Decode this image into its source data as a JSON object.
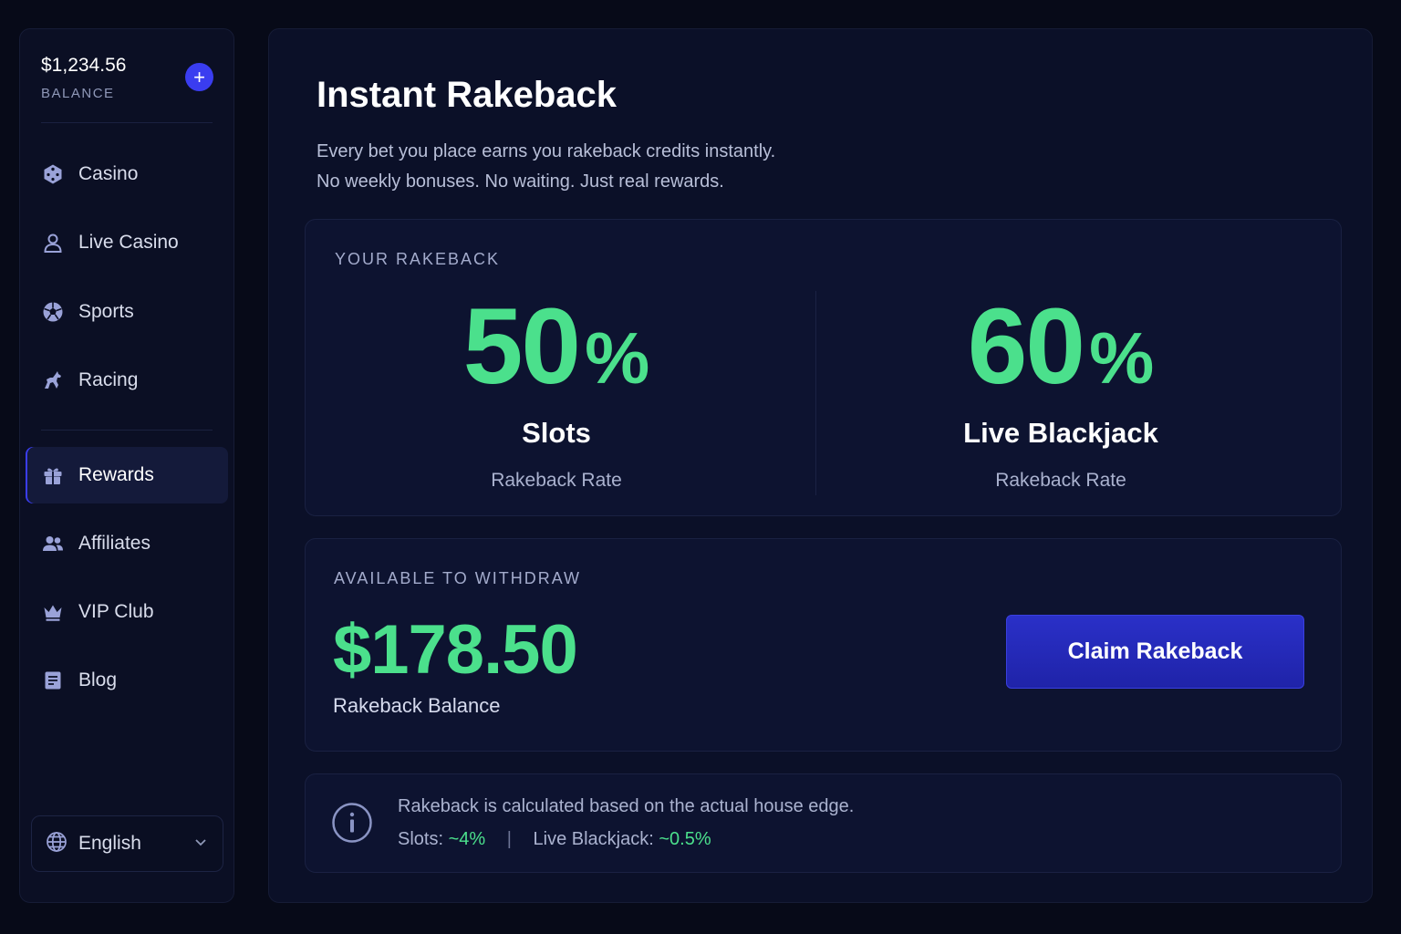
{
  "sidebar": {
    "balance_amount": "$1,234.56",
    "balance_label": "BALANCE",
    "add_label": "+",
    "items": [
      {
        "label": "Casino",
        "icon": "dice-icon"
      },
      {
        "label": "Live Casino",
        "icon": "user-icon"
      },
      {
        "label": "Sports",
        "icon": "soccer-ball-icon"
      },
      {
        "label": "Racing",
        "icon": "horse-icon"
      },
      {
        "label": "Rewards",
        "icon": "gift-icon",
        "active": true
      },
      {
        "label": "Affiliates",
        "icon": "users-icon"
      },
      {
        "label": "VIP Club",
        "icon": "crown-icon"
      },
      {
        "label": "Blog",
        "icon": "document-icon"
      }
    ],
    "language": "English"
  },
  "main": {
    "title": "Instant Rakeback",
    "subtitle_line1": "Every bet you place earns you rakeback credits instantly.",
    "subtitle_line2": "No weekly bonuses. No waiting. Just real rewards.",
    "rakeback": {
      "label": "YOUR RAKEBACK",
      "rates": [
        {
          "value": "50",
          "unit": "%",
          "name": "Slots",
          "sub": "Rakeback Rate"
        },
        {
          "value": "60",
          "unit": "%",
          "name": "Live Blackjack",
          "sub": "Rakeback Rate"
        }
      ]
    },
    "withdraw": {
      "label": "AVAILABLE TO WITHDRAW",
      "amount": "$178.50",
      "amount_sub": "Rakeback Balance",
      "button": "Claim Rakeback"
    },
    "info": {
      "line1": "Rakeback is calculated based on the actual house edge.",
      "slots_label": "Slots:",
      "slots_value": "~4%",
      "separator": "|",
      "bj_label": "Live Blackjack:",
      "bj_value": "~0.5%"
    }
  },
  "colors": {
    "accent": "#3a3df0",
    "positive": "#4be08c",
    "background": "#070a18",
    "panel": "#0b1028"
  }
}
